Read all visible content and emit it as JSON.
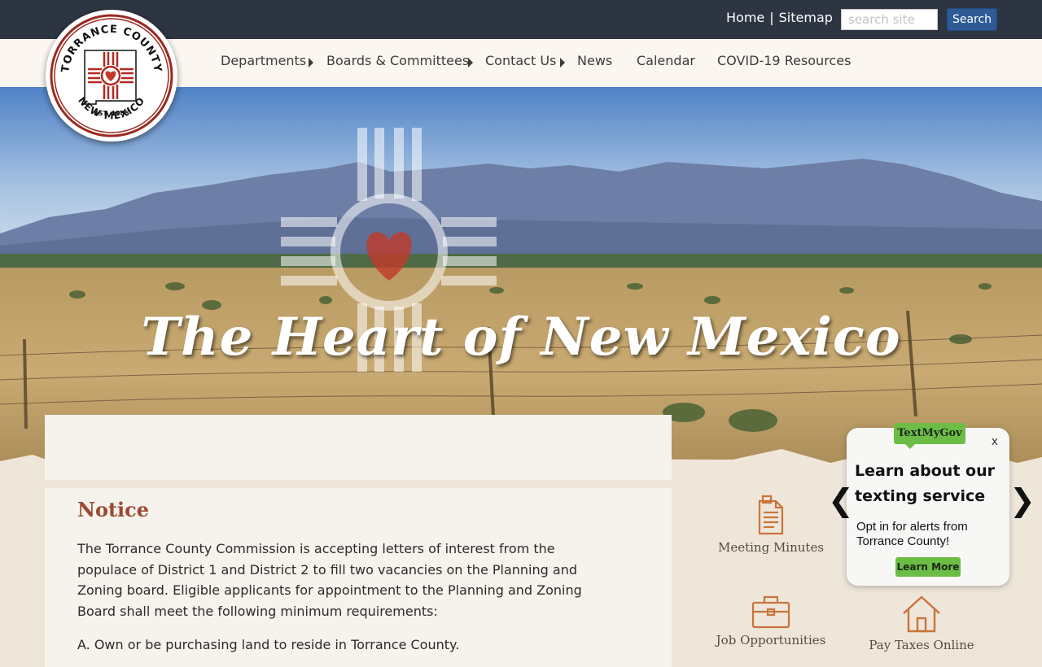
{
  "utility": {
    "home": "Home",
    "separator": "|",
    "sitemap": "Sitemap",
    "search_placeholder": "search site",
    "search_button": "Search"
  },
  "nav": [
    {
      "label": "Departments",
      "has_submenu": true
    },
    {
      "label": "Boards & Committees",
      "has_submenu": true
    },
    {
      "label": "Contact Us",
      "has_submenu": true
    },
    {
      "label": "News",
      "has_submenu": false
    },
    {
      "label": "Calendar",
      "has_submenu": false
    },
    {
      "label": "COVID-19 Resources",
      "has_submenu": false
    }
  ],
  "logo": {
    "top_text": "TORRANCE COUNTY",
    "est": "EST. 1905",
    "bottom_text": "NEW MEXICO"
  },
  "hero": {
    "title": "The Heart of New Mexico"
  },
  "notice": {
    "title": "Notice",
    "body": "The Torrance County Commission is accepting letters of interest from the populace of District 1 and District 2 to fill two vacancies on the Planning and Zoning board. Eligible applicants for appointment to the Planning and Zoning Board shall meet the following minimum requirements:",
    "requirement_a": "A. Own or be purchasing land to reside in Torrance County."
  },
  "quick_links": [
    {
      "label": "Meeting Minutes",
      "icon": "document-icon"
    },
    {
      "label": "Job Opportunities",
      "icon": "briefcase-icon"
    },
    {
      "label": "Pay Taxes Online",
      "icon": "house-icon"
    }
  ],
  "textmygov": {
    "badge": "TextMyGov",
    "close": "x",
    "heading": "Learn about our texting service",
    "body": "Opt in for alerts from Torrance County!",
    "button": "Learn More",
    "prev": "❮",
    "next": "❯"
  },
  "colors": {
    "topbar": "#2c3541",
    "nav_bg": "#fbf6ef",
    "accent_red": "#9b4a33",
    "search_button": "#2e5a96",
    "textmygov_green": "#6bbd45",
    "icon_orange": "#c8743c"
  }
}
